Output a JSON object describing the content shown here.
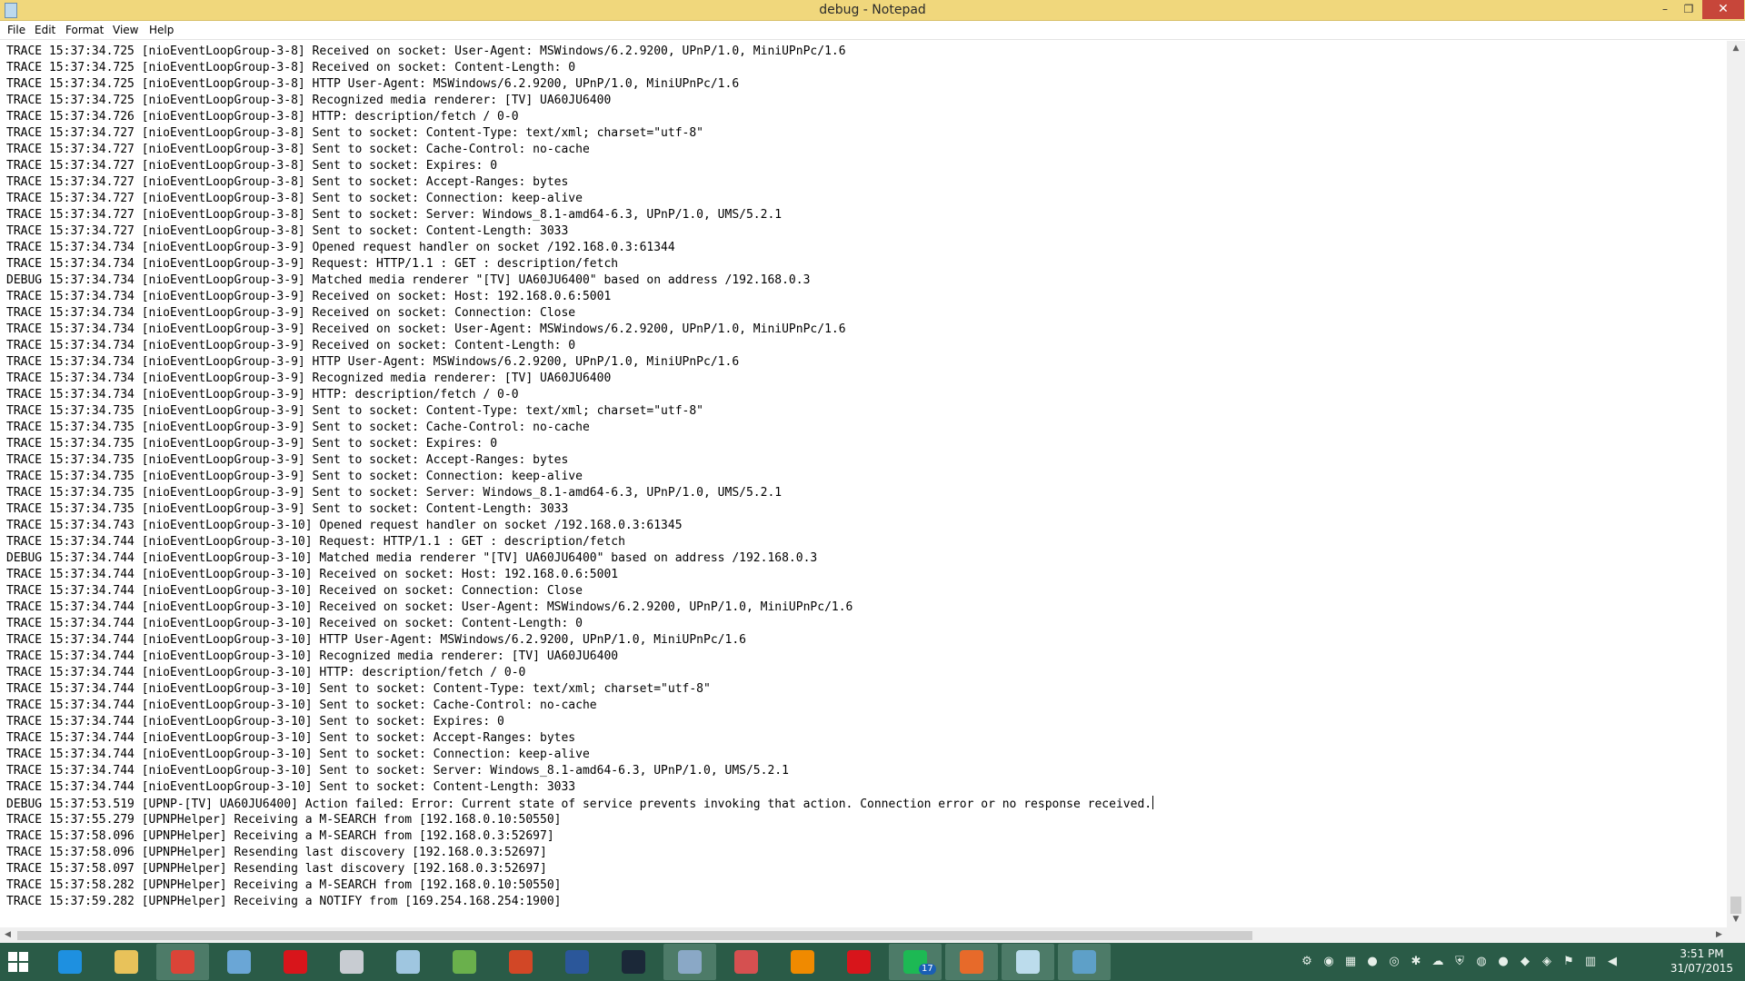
{
  "window": {
    "title": "debug - Notepad",
    "controls": {
      "minimize": "–",
      "maximize": "❐",
      "close": "✕"
    }
  },
  "menu": [
    "File",
    "Edit",
    "Format",
    "View",
    "Help"
  ],
  "log_lines": [
    "TRACE 15:37:34.725 [nioEventLoopGroup-3-8] Received on socket: User-Agent: MSWindows/6.2.9200, UPnP/1.0, MiniUPnPc/1.6",
    "TRACE 15:37:34.725 [nioEventLoopGroup-3-8] Received on socket: Content-Length: 0",
    "TRACE 15:37:34.725 [nioEventLoopGroup-3-8] HTTP User-Agent: MSWindows/6.2.9200, UPnP/1.0, MiniUPnPc/1.6",
    "TRACE 15:37:34.725 [nioEventLoopGroup-3-8] Recognized media renderer: [TV] UA60JU6400",
    "TRACE 15:37:34.726 [nioEventLoopGroup-3-8] HTTP: description/fetch / 0-0",
    "TRACE 15:37:34.727 [nioEventLoopGroup-3-8] Sent to socket: Content-Type: text/xml; charset=\"utf-8\"",
    "TRACE 15:37:34.727 [nioEventLoopGroup-3-8] Sent to socket: Cache-Control: no-cache",
    "TRACE 15:37:34.727 [nioEventLoopGroup-3-8] Sent to socket: Expires: 0",
    "TRACE 15:37:34.727 [nioEventLoopGroup-3-8] Sent to socket: Accept-Ranges: bytes",
    "TRACE 15:37:34.727 [nioEventLoopGroup-3-8] Sent to socket: Connection: keep-alive",
    "TRACE 15:37:34.727 [nioEventLoopGroup-3-8] Sent to socket: Server: Windows_8.1-amd64-6.3, UPnP/1.0, UMS/5.2.1",
    "TRACE 15:37:34.727 [nioEventLoopGroup-3-8] Sent to socket: Content-Length: 3033",
    "TRACE 15:37:34.734 [nioEventLoopGroup-3-9] Opened request handler on socket /192.168.0.3:61344",
    "TRACE 15:37:34.734 [nioEventLoopGroup-3-9] Request: HTTP/1.1 : GET : description/fetch",
    "DEBUG 15:37:34.734 [nioEventLoopGroup-3-9] Matched media renderer \"[TV] UA60JU6400\" based on address /192.168.0.3",
    "TRACE 15:37:34.734 [nioEventLoopGroup-3-9] Received on socket: Host: 192.168.0.6:5001",
    "TRACE 15:37:34.734 [nioEventLoopGroup-3-9] Received on socket: Connection: Close",
    "TRACE 15:37:34.734 [nioEventLoopGroup-3-9] Received on socket: User-Agent: MSWindows/6.2.9200, UPnP/1.0, MiniUPnPc/1.6",
    "TRACE 15:37:34.734 [nioEventLoopGroup-3-9] Received on socket: Content-Length: 0",
    "TRACE 15:37:34.734 [nioEventLoopGroup-3-9] HTTP User-Agent: MSWindows/6.2.9200, UPnP/1.0, MiniUPnPc/1.6",
    "TRACE 15:37:34.734 [nioEventLoopGroup-3-9] Recognized media renderer: [TV] UA60JU6400",
    "TRACE 15:37:34.734 [nioEventLoopGroup-3-9] HTTP: description/fetch / 0-0",
    "TRACE 15:37:34.735 [nioEventLoopGroup-3-9] Sent to socket: Content-Type: text/xml; charset=\"utf-8\"",
    "TRACE 15:37:34.735 [nioEventLoopGroup-3-9] Sent to socket: Cache-Control: no-cache",
    "TRACE 15:37:34.735 [nioEventLoopGroup-3-9] Sent to socket: Expires: 0",
    "TRACE 15:37:34.735 [nioEventLoopGroup-3-9] Sent to socket: Accept-Ranges: bytes",
    "TRACE 15:37:34.735 [nioEventLoopGroup-3-9] Sent to socket: Connection: keep-alive",
    "TRACE 15:37:34.735 [nioEventLoopGroup-3-9] Sent to socket: Server: Windows_8.1-amd64-6.3, UPnP/1.0, UMS/5.2.1",
    "TRACE 15:37:34.735 [nioEventLoopGroup-3-9] Sent to socket: Content-Length: 3033",
    "TRACE 15:37:34.743 [nioEventLoopGroup-3-10] Opened request handler on socket /192.168.0.3:61345",
    "TRACE 15:37:34.744 [nioEventLoopGroup-3-10] Request: HTTP/1.1 : GET : description/fetch",
    "DEBUG 15:37:34.744 [nioEventLoopGroup-3-10] Matched media renderer \"[TV] UA60JU6400\" based on address /192.168.0.3",
    "TRACE 15:37:34.744 [nioEventLoopGroup-3-10] Received on socket: Host: 192.168.0.6:5001",
    "TRACE 15:37:34.744 [nioEventLoopGroup-3-10] Received on socket: Connection: Close",
    "TRACE 15:37:34.744 [nioEventLoopGroup-3-10] Received on socket: User-Agent: MSWindows/6.2.9200, UPnP/1.0, MiniUPnPc/1.6",
    "TRACE 15:37:34.744 [nioEventLoopGroup-3-10] Received on socket: Content-Length: 0",
    "TRACE 15:37:34.744 [nioEventLoopGroup-3-10] HTTP User-Agent: MSWindows/6.2.9200, UPnP/1.0, MiniUPnPc/1.6",
    "TRACE 15:37:34.744 [nioEventLoopGroup-3-10] Recognized media renderer: [TV] UA60JU6400",
    "TRACE 15:37:34.744 [nioEventLoopGroup-3-10] HTTP: description/fetch / 0-0",
    "TRACE 15:37:34.744 [nioEventLoopGroup-3-10] Sent to socket: Content-Type: text/xml; charset=\"utf-8\"",
    "TRACE 15:37:34.744 [nioEventLoopGroup-3-10] Sent to socket: Cache-Control: no-cache",
    "TRACE 15:37:34.744 [nioEventLoopGroup-3-10] Sent to socket: Expires: 0",
    "TRACE 15:37:34.744 [nioEventLoopGroup-3-10] Sent to socket: Accept-Ranges: bytes",
    "TRACE 15:37:34.744 [nioEventLoopGroup-3-10] Sent to socket: Connection: keep-alive",
    "TRACE 15:37:34.744 [nioEventLoopGroup-3-10] Sent to socket: Server: Windows_8.1-amd64-6.3, UPnP/1.0, UMS/5.2.1",
    "TRACE 15:37:34.744 [nioEventLoopGroup-3-10] Sent to socket: Content-Length: 3033",
    "DEBUG 15:37:53.519 [UPNP-[TV] UA60JU6400] Action failed: Error: Current state of service prevents invoking that action. Connection error or no response received.",
    "TRACE 15:37:55.279 [UPNPHelper] Receiving a M-SEARCH from [192.168.0.10:50550]",
    "TRACE 15:37:58.096 [UPNPHelper] Receiving a M-SEARCH from [192.168.0.3:52697]",
    "TRACE 15:37:58.096 [UPNPHelper] Resending last discovery [192.168.0.3:52697]",
    "TRACE 15:37:58.097 [UPNPHelper] Resending last discovery [192.168.0.3:52697]",
    "TRACE 15:37:58.282 [UPNPHelper] Receiving a M-SEARCH from [192.168.0.10:50550]",
    "TRACE 15:37:59.282 [UPNPHelper] Receiving a NOTIFY from [169.254.168.254:1900]"
  ],
  "caret_line": 46,
  "taskbar": {
    "apps": [
      {
        "name": "internet-explorer",
        "color": "#1e90e0",
        "active": false
      },
      {
        "name": "file-explorer",
        "color": "#e8c25a",
        "active": false
      },
      {
        "name": "chrome",
        "color": "#db4437",
        "active": true
      },
      {
        "name": "file-manager",
        "color": "#6aa6d6",
        "active": false
      },
      {
        "name": "opera",
        "color": "#d8151b",
        "active": false
      },
      {
        "name": "calculator",
        "color": "#c8ccd2",
        "active": false
      },
      {
        "name": "paint-tool",
        "color": "#9fc6e0",
        "active": false
      },
      {
        "name": "project",
        "color": "#6ab04c",
        "active": false
      },
      {
        "name": "powerpoint",
        "color": "#d24726",
        "active": false
      },
      {
        "name": "word",
        "color": "#2b579a",
        "active": false
      },
      {
        "name": "steam",
        "color": "#1b2838",
        "active": false
      },
      {
        "name": "remote-desktop",
        "color": "#8aa8c6",
        "active": true
      },
      {
        "name": "tools",
        "color": "#d55050",
        "active": false
      },
      {
        "name": "vlc",
        "color": "#f08a00",
        "active": false
      },
      {
        "name": "opera-alt",
        "color": "#d8151b",
        "active": false
      },
      {
        "name": "spotify",
        "color": "#1db954",
        "active": true,
        "badge": "17"
      },
      {
        "name": "media-app",
        "color": "#e76a2a",
        "active": true
      },
      {
        "name": "notepad",
        "color": "#bcdcec",
        "active": true
      },
      {
        "name": "ums-app",
        "color": "#5ea0c8",
        "active": true
      }
    ],
    "tray_icons": [
      "ums-tray-icon",
      "adobe-tray-icon",
      "windows-tray-icon",
      "spotify-tray-icon",
      "chrome-tray-icon",
      "settings-tray-icon",
      "cloud-tray-icon",
      "shield-tray-icon",
      "steam-tray-icon",
      "record-tray-icon",
      "acrobat-tray-icon",
      "defender-tray-icon",
      "flag-tray-icon",
      "network-tray-icon",
      "volume-tray-icon"
    ],
    "time": "3:51 PM",
    "date": "31/07/2015"
  }
}
